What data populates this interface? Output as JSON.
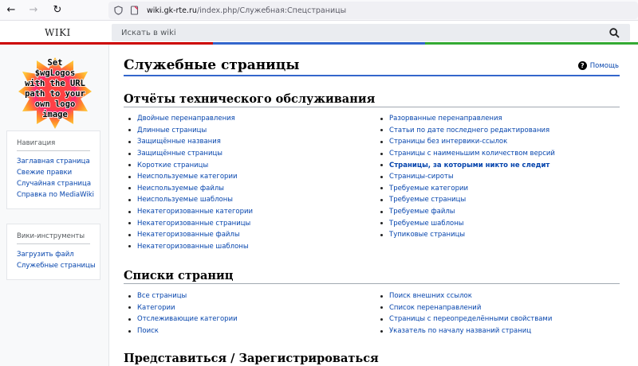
{
  "browser": {
    "back": "←",
    "forward": "→",
    "reload": "↻",
    "url_domain": "wiki.gk-rte.ru",
    "url_path": "/index.php/Служебная:Спецстраницы"
  },
  "header": {
    "wordmark": "WIKI",
    "search_placeholder": "Искать в wiki"
  },
  "sidebar": {
    "logo_text": "Set $wgLogos with the URL path to your own logo image",
    "nav_heading": "Навигация",
    "nav_items": [
      "Заглавная страница",
      "Свежие правки",
      "Случайная страница",
      "Справка по MediaWiki"
    ],
    "tools_heading": "Вики-инструменты",
    "tools_items": [
      "Загрузить файл",
      "Служебные страницы"
    ]
  },
  "main": {
    "title": "Служебные страницы",
    "help": "Помощь",
    "sections": [
      {
        "title": "Отчёты технического обслуживания",
        "left": [
          "Двойные перенаправления",
          "Длинные страницы",
          "Защищённые названия",
          "Защищённые страницы",
          "Короткие страницы",
          "Неиспользуемые категории",
          "Неиспользуемые файлы",
          "Неиспользуемые шаблоны",
          "Некатегоризованные категории",
          "Некатегоризованные страницы",
          "Некатегоризованные файлы",
          "Некатегоризованные шаблоны"
        ],
        "right": [
          "Разорванные перенаправления",
          "Статьи по дате последнего редактирования",
          "Страницы без интервики-ссылок",
          "Страницы с наименьшим количеством версий",
          "Страницы, за которыми никто не следит",
          "Страницы-сироты",
          "Требуемые категории",
          "Требуемые страницы",
          "Требуемые файлы",
          "Требуемые шаблоны",
          "Тупиковые страницы"
        ]
      },
      {
        "title": "Списки страниц",
        "left": [
          "Все страницы",
          "Категории",
          "Отслеживающие категории",
          "Поиск"
        ],
        "right": [
          "Поиск внешних ссылок",
          "Список перенаправлений",
          "Страницы с переопределёнными свойствами",
          "Указатель по началу названий страниц"
        ]
      },
      {
        "title": "Представиться / Зарегистрироваться"
      }
    ]
  },
  "colors": {
    "link": "#0645ad",
    "accent_blue": "#36c",
    "stripe": [
      "#c00",
      "#36c",
      "#3a3"
    ]
  }
}
